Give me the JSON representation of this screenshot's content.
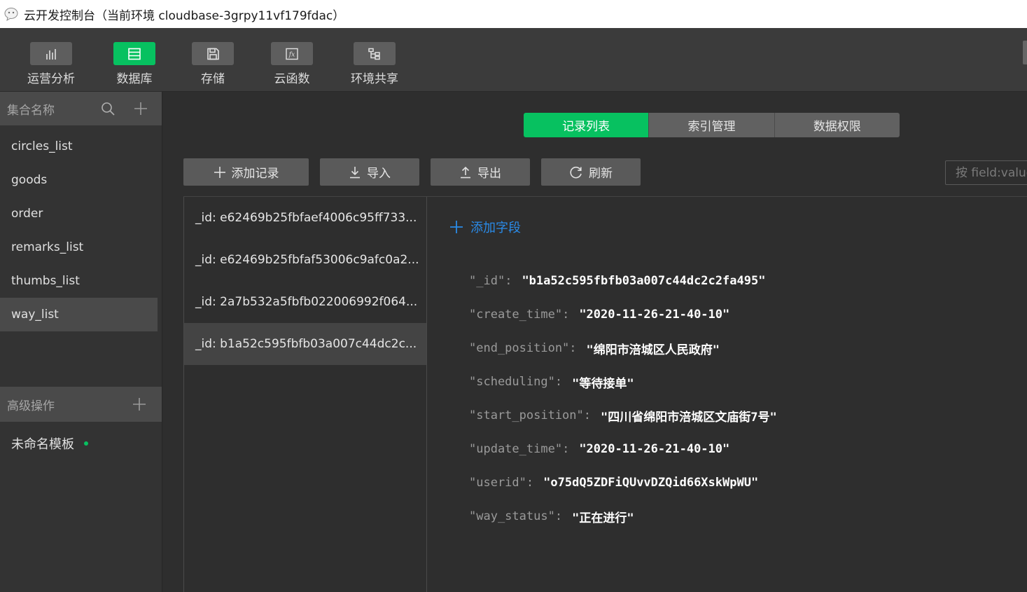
{
  "window": {
    "title": "云开发控制台（当前环境 cloudbase-3grpy11vf179fdac）"
  },
  "toolbar": {
    "items": [
      {
        "label": "运营分析",
        "icon": "bar-chart-icon"
      },
      {
        "label": "数据库",
        "icon": "database-icon",
        "active": true
      },
      {
        "label": "存储",
        "icon": "storage-icon"
      },
      {
        "label": "云函数",
        "icon": "function-icon"
      },
      {
        "label": "环境共享",
        "icon": "share-tree-icon"
      }
    ]
  },
  "sidebar": {
    "header_label": "集合名称",
    "collections": [
      "circles_list",
      "goods",
      "order",
      "remarks_list",
      "thumbs_list",
      "way_list"
    ],
    "selected_collection": "way_list",
    "advanced_label": "高级操作",
    "template_label": "未命名模板"
  },
  "main": {
    "tabs": [
      "记录列表",
      "索引管理",
      "数据权限"
    ],
    "active_tab": "记录列表",
    "actions": {
      "add": "添加记录",
      "import": "导入",
      "export": "导出",
      "refresh": "刷新"
    },
    "search_placeholder": "按 field:value",
    "records": [
      "_id: e62469b25fbfaef4006c95ff733...",
      "_id: e62469b25fbfaf53006c9afc0a2...",
      "_id: 2a7b532a5fbfb022006992f064...",
      "_id: b1a52c595fbfb03a007c44dc2c..."
    ],
    "selected_record_index": 3,
    "add_field_label": "添加字段",
    "fields": [
      {
        "key": "\"_id\"",
        "value": "\"b1a52c595fbfb03a007c44dc2c2fa495\""
      },
      {
        "key": "\"create_time\"",
        "value": "\"2020-11-26-21-40-10\""
      },
      {
        "key": "\"end_position\"",
        "value": "\"绵阳市涪城区人民政府\""
      },
      {
        "key": "\"scheduling\"",
        "value": "\"等待接单\""
      },
      {
        "key": "\"start_position\"",
        "value": "\"四川省绵阳市涪城区文庙街7号\""
      },
      {
        "key": "\"update_time\"",
        "value": "\"2020-11-26-21-40-10\""
      },
      {
        "key": "\"userid\"",
        "value": "\"o75dQ5ZDFiQUvvDZQid66XskWpWU\""
      },
      {
        "key": "\"way_status\"",
        "value": "\"正在进行\""
      }
    ]
  },
  "colors": {
    "accent": "#07c160",
    "link": "#2a8be8",
    "background": "#2e2e2e"
  }
}
